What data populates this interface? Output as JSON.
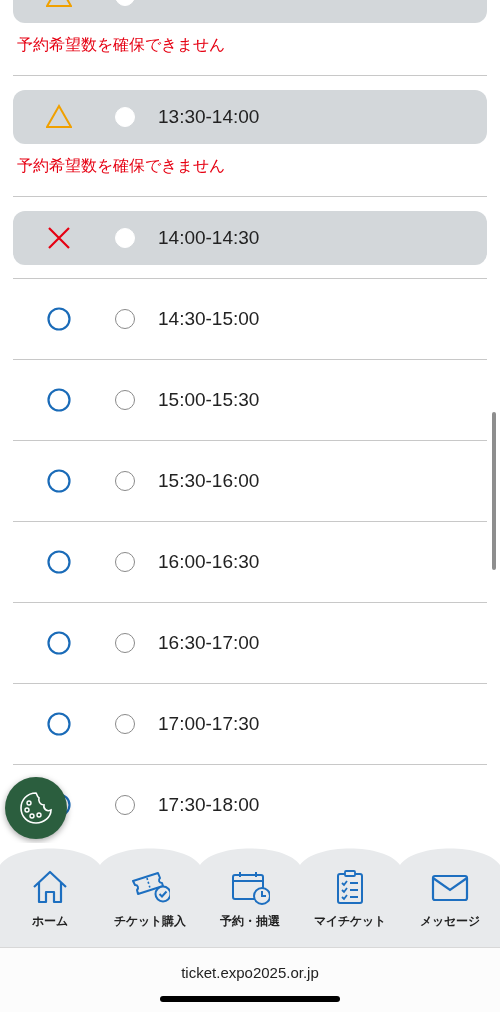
{
  "slots": [
    {
      "kind": "limited",
      "disabled": true,
      "selected": false,
      "message": "予約希望数を確保できません"
    },
    {
      "kind": "limited",
      "disabled": true,
      "selected": false,
      "time": "13:30-14:00",
      "message": "予約希望数を確保できません"
    },
    {
      "kind": "full",
      "disabled": true,
      "selected": false,
      "time": "14:00-14:30"
    },
    {
      "kind": "available",
      "disabled": false,
      "selected": false,
      "time": "14:30-15:00"
    },
    {
      "kind": "available",
      "disabled": false,
      "selected": false,
      "time": "15:00-15:30"
    },
    {
      "kind": "available",
      "disabled": false,
      "selected": false,
      "time": "15:30-16:00"
    },
    {
      "kind": "available",
      "disabled": false,
      "selected": false,
      "time": "16:00-16:30"
    },
    {
      "kind": "available",
      "disabled": false,
      "selected": false,
      "time": "16:30-17:00"
    },
    {
      "kind": "available",
      "disabled": false,
      "selected": false,
      "time": "17:00-17:30"
    },
    {
      "kind": "available",
      "disabled": false,
      "selected": false,
      "time": "17:30-18:00"
    }
  ],
  "tab_bar": [
    {
      "label": "ホーム"
    },
    {
      "label": "チケット購入"
    },
    {
      "label": "予約・抽選"
    },
    {
      "label": "マイチケット"
    },
    {
      "label": "メッセージ"
    }
  ],
  "url": "ticket.expo2025.or.jp"
}
